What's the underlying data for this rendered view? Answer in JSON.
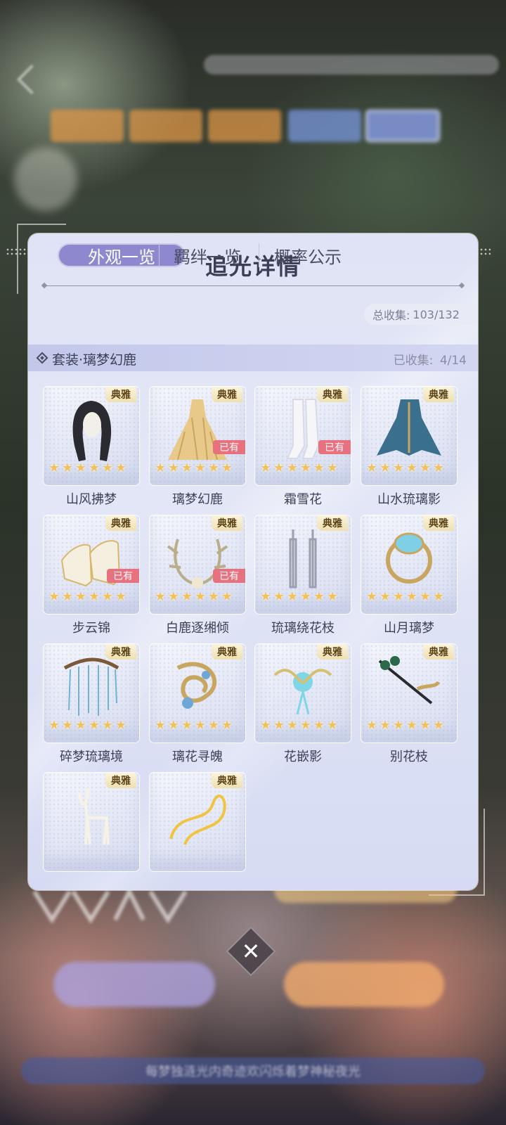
{
  "background": {
    "ticker_text": "每梦独涟光内奇迹欢闪烁着梦神秘夜光"
  },
  "panel": {
    "title": "追光详情",
    "tabs": [
      {
        "label": "外观一览",
        "active": true
      },
      {
        "label": "羁绊一览",
        "active": false
      },
      {
        "label": "概率公示",
        "active": false
      }
    ],
    "total": {
      "label": "总收集:",
      "value": "103/132"
    },
    "set": {
      "name": "套装·璃梦幻鹿",
      "collected_label": "已收集:",
      "collected_value": "4/14"
    },
    "badge_text": "典雅",
    "owned_text": "已有",
    "items": [
      {
        "label": "山风拂梦",
        "owned": false,
        "stars": 6,
        "icon": "hair-icon"
      },
      {
        "label": "璃梦幻鹿",
        "owned": true,
        "stars": 6,
        "icon": "dress-icon"
      },
      {
        "label": "霜雪花",
        "owned": true,
        "stars": 6,
        "icon": "stockings-icon"
      },
      {
        "label": "山水琉璃影",
        "owned": false,
        "stars": 6,
        "icon": "jacket-icon"
      },
      {
        "label": "步云锦",
        "owned": true,
        "stars": 6,
        "icon": "shoes-icon"
      },
      {
        "label": "白鹿逐缃倾",
        "owned": true,
        "stars": 6,
        "icon": "antler-crown-icon"
      },
      {
        "label": "琉璃绕花枝",
        "owned": false,
        "stars": 6,
        "icon": "earrings-icon"
      },
      {
        "label": "山月璃梦",
        "owned": false,
        "stars": 6,
        "icon": "ring-icon"
      },
      {
        "label": "碎梦琉璃境",
        "owned": false,
        "stars": 6,
        "icon": "headpiece-icon"
      },
      {
        "label": "璃花寻魄",
        "owned": false,
        "stars": 6,
        "icon": "brooch-icon"
      },
      {
        "label": "花嵌影",
        "owned": false,
        "stars": 6,
        "icon": "flower-ornament-icon"
      },
      {
        "label": "别花枝",
        "owned": false,
        "stars": 6,
        "icon": "hairpin-icon"
      },
      {
        "label": "",
        "owned": false,
        "stars": 0,
        "icon": "deer-icon"
      },
      {
        "label": "",
        "owned": false,
        "stars": 0,
        "icon": "ribbon-icon"
      }
    ]
  },
  "close_label": "✕",
  "colors": {
    "accent": "#8e88cf",
    "owned": "#e7717f",
    "star": "#f1c15a",
    "badge": "#efe0b1"
  }
}
